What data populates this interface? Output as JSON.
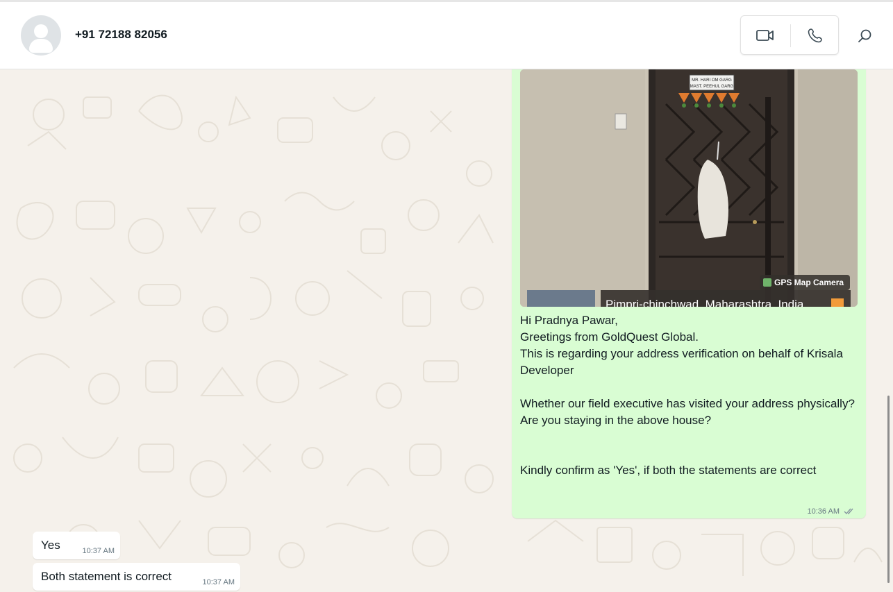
{
  "header": {
    "contact_name": "+91 72188 82056",
    "icons": {
      "avatar": "default-avatar",
      "video": "video-camera-icon",
      "voice": "phone-icon",
      "search": "search-icon"
    }
  },
  "messages": {
    "outgoing": {
      "photo_caption": "GPS Map Camera",
      "photo_location": "Pimpri-chinchwad, Maharashtra, India",
      "photo_sign_line1": "MR. HARI OM GARG",
      "photo_sign_line2": "MAST. PEEHUL GARG",
      "text": "Hi Pradnya Pawar,\nGreetings from GoldQuest Global.\nThis is regarding your address verification on behalf of Krisala Developer\n\nWhether our field executive has visited your address physically?\nAre you staying in the above house?\n\n\nKindly confirm as 'Yes', if both the statements are correct",
      "time": "10:36 AM",
      "status_icon": "double-check-icon"
    },
    "incoming": [
      {
        "text": "Yes",
        "time": "10:37 AM"
      },
      {
        "text": "Both statement is correct",
        "time": "10:37 AM"
      }
    ]
  },
  "colors": {
    "outgoing_bubble": "#d9fdd3",
    "incoming_bubble": "#ffffff",
    "wallpaper": "#f5f1eb",
    "header_bg": "#ffffff"
  }
}
